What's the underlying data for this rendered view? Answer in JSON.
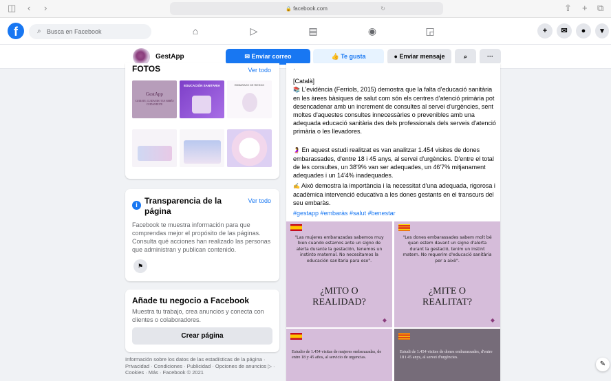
{
  "safari": {
    "url": "facebook.com",
    "sidebar_icon": "sidebar-icon",
    "back_icon": "back-icon",
    "forward_icon": "forward-icon",
    "lock_icon": "lock-icon",
    "reload_icon": "reload-icon",
    "share_icon": "share-icon",
    "new_tab_icon": "plus-icon",
    "tabs_icon": "tabs-icon"
  },
  "fb": {
    "logo": "f",
    "search_placeholder": "Busca en Facebook",
    "nav_icons": [
      "home-icon",
      "watch-icon",
      "marketplace-icon",
      "groups-icon",
      "gaming-icon"
    ],
    "right_icons": [
      "plus-icon",
      "messenger-icon",
      "notifications-icon",
      "account-menu-icon"
    ]
  },
  "page_header": {
    "name": "GestApp",
    "send_email": "Enviar correo",
    "like": "Te gusta",
    "message": "Enviar mensaje",
    "search_icon": "search-icon",
    "more": "···"
  },
  "photos": {
    "title": "Fotos",
    "see_all": "Ver todo",
    "thumb1": {
      "brand": "GestApp",
      "sub": "CUIDATE, CUIDANDO TUS BEBÉS CUIDANDOTE"
    },
    "thumb2": {
      "title": "EDUCACIÓN SANITARIA"
    },
    "thumb3": {
      "title": "EMBARAZO DE RIESGO"
    }
  },
  "transparency": {
    "title": "Transparencia de la página",
    "see_all": "Ver todo",
    "body": "Facebook te muestra información para que comprendas mejor el propósito de las páginas. Consulta qué acciones han realizado las personas que administran y publican contenido."
  },
  "business": {
    "title": "Añade tu negocio a Facebook",
    "body": "Muestra tu trabajo, crea anuncios y conecta con clientes o colaboradores.",
    "button": "Crear página"
  },
  "footer": "Información sobre los datos de las estadísticas de la página · Privacidad · Condiciones · Publicidad · Opciones de anuncios ▷ · Cookies · Más · Facebook © 2021",
  "post": {
    "dot": "·",
    "lang": "[Català]",
    "p1_icon": "📚",
    "p1": "L'evidència (Ferriols, 2015) demostra que la falta d'educació sanitària en les àrees bàsiques de salut com són els centres d'atenció primària pot desencadenar amb un increment de consultes al servei d'urgències, sent moltes d'aquestes consultes innecessàries o prevenibles amb una adequada educació sanitària des dels professionals dels serveis d'atenció primària o les llevadores.",
    "p2_icon": "🤰",
    "p2": "En aquest estudi realitzat es van analitzar 1.454 visites de dones embarassades, d'entre 18 i 45 anys, al servei d'urgències. D'entre el total de les consultes, un 38'9% van ser adequades, un 46'7% mitjanament adequades i un 14'4% inadequades.",
    "p3_icon": "✍️",
    "p3": "Això demostra la importància i la necessitat d'una adequada, rigorosa i acadèmica intervenció educativa a les dones gestants en el transcurs del seu embaràs.",
    "hashtags": "#gestapp #embaràs #salut #benestar"
  },
  "tiles": {
    "es_quote": "\"Las mujeres embarazadas sabemos muy bien cuando estamos ante un signo de alerta durante la gestación, tenemos un instinto maternal. No necesitamos la educación sanitaria para eso\".",
    "es_big1": "¿MITO O",
    "es_big2": "REALIDAD?",
    "ca_quote": "\"Les dones embarassades sabem molt bé quan estem davant un signe d'alerta durant la gestació, tenim un instint matern. No requerim d'educació sanitària per a això\".",
    "ca_big1": "¿MITE O",
    "ca_big2": "REALITAT?",
    "es_study": "Estudio de 1.454 visitas de mujeres embarazadas, de entre 18 y 45 años, al servicio de urgencias.",
    "ca_study": "Estudi de 1.454 visites de dones embarassades, d'entre 18 i 45 anys, al servei d'urgències."
  },
  "edit_icon": "compose-icon",
  "colors": {
    "accent": "#1877f2",
    "tile_lilac": "#d3b9d8",
    "tile_gray": "#766c79"
  }
}
